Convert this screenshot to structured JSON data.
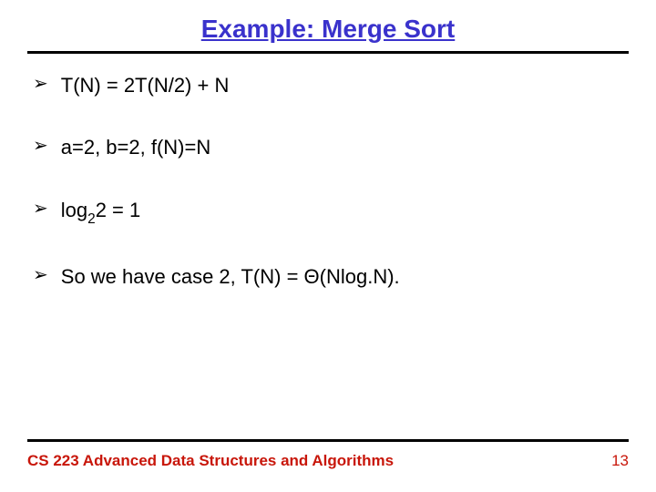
{
  "title": "Example: Merge Sort",
  "bullets": {
    "b0": {
      "html": "T(N) = 2T(N/2) + N"
    },
    "b1": {
      "html": "a=2, b=2, f(N)=N"
    },
    "b2": {
      "html": "log<span class=\"sub\">2</span>2 = 1"
    },
    "b3": {
      "html": "So we have case 2, T(N) = Θ(Nlog.N)."
    }
  },
  "footer": {
    "course": "CS 223 Advanced Data Structures and Algorithms",
    "page": "13"
  }
}
